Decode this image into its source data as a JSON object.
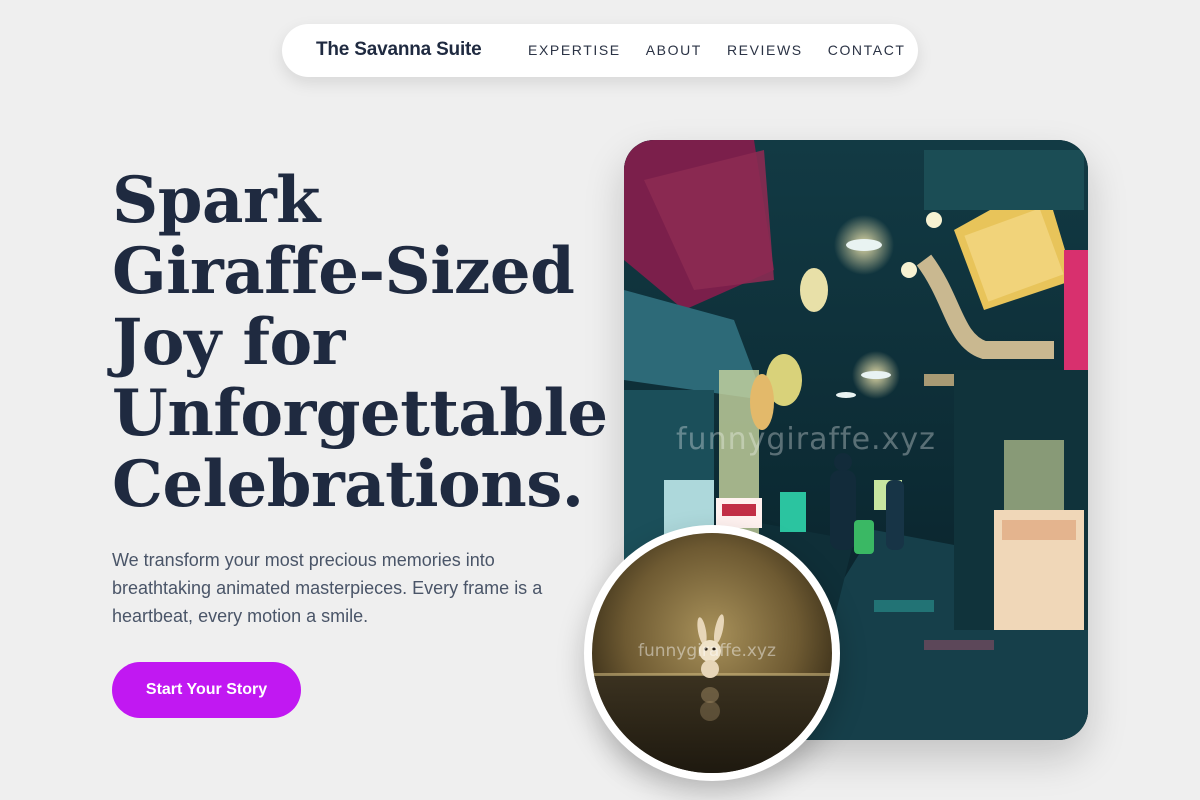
{
  "nav": {
    "brand": "The Savanna Suite",
    "links": [
      {
        "label": "EXPERTISE"
      },
      {
        "label": "ABOUT"
      },
      {
        "label": "REVIEWS"
      },
      {
        "label": "CONTACT"
      }
    ]
  },
  "hero": {
    "headline_lines": [
      "Spark",
      "Giraffe-Sized",
      "Joy for",
      "Unforgettable",
      "Celebrations."
    ],
    "subtext": "We transform your most precious memories into breathtaking animated masterpieces. Every frame is a heartbeat, every motion a smile.",
    "cta_label": "Start Your Story"
  },
  "images": {
    "main_watermark": "funnygiraffe.xyz",
    "round_watermark": "funnygiraffe.xyz"
  },
  "colors": {
    "background": "#efefef",
    "accent": "#c118f2",
    "heading": "#1f2a40"
  }
}
